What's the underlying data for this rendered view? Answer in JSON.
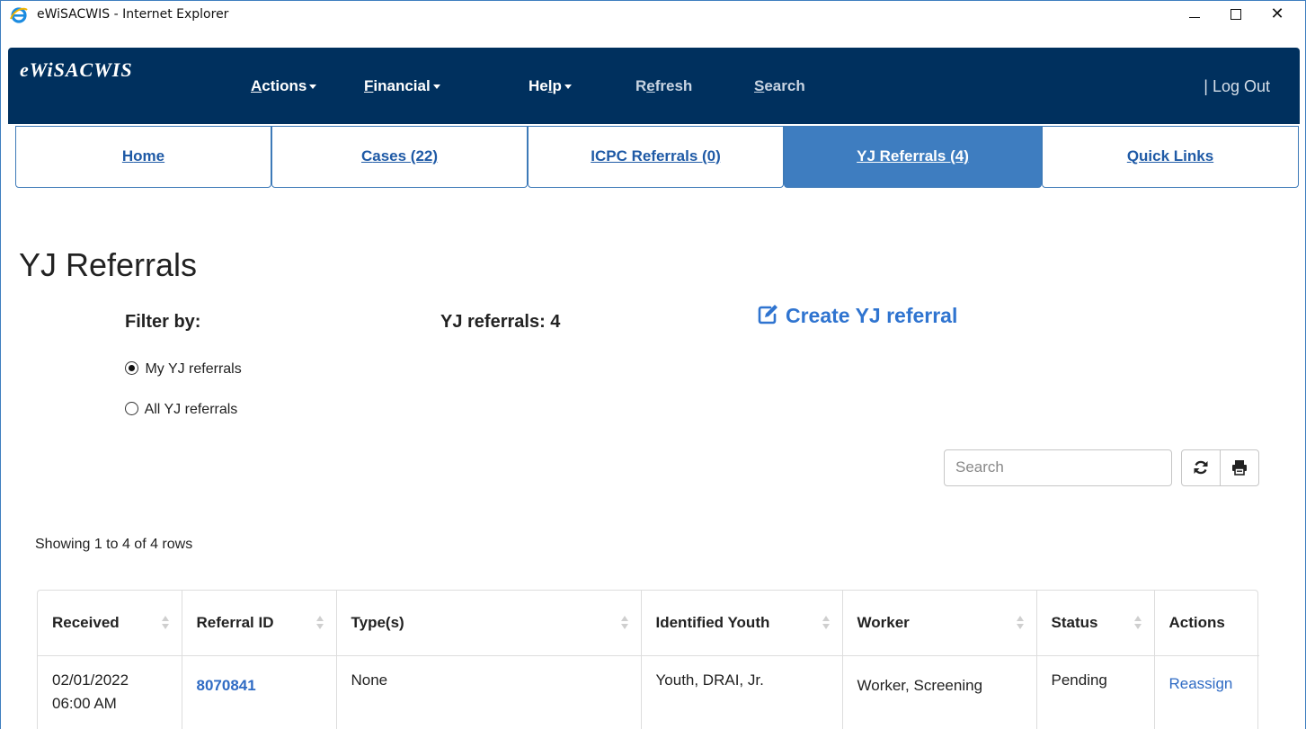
{
  "window": {
    "title": "eWiSACWIS - Internet Explorer",
    "icon": "internet-explorer-icon",
    "controls": {
      "minimize": "minimize-icon",
      "maximize": "maximize-icon",
      "close": "✕"
    }
  },
  "appbar": {
    "logo": "eWiSACWIS",
    "nav": {
      "actions": {
        "first": "A",
        "rest": "ctions"
      },
      "financial": {
        "first": "F",
        "rest": "inancial"
      },
      "help": {
        "pre": "He",
        "u": "l",
        "post": "p"
      },
      "refresh": {
        "pre": "R",
        "u": "e",
        "post": "fresh"
      },
      "search": {
        "first": "S",
        "rest": "earch"
      }
    },
    "logout": "| Log Out",
    "colors": {
      "background": "#00305e",
      "tab_active": "#3e7dc0",
      "link": "#2f74d0"
    }
  },
  "tabs": [
    {
      "pre": "",
      "u": "H",
      "post": "ome",
      "active": false
    },
    {
      "pre": "",
      "u": "C",
      "post": "ases (22)",
      "active": false
    },
    {
      "pre": "",
      "u": "I",
      "post": "CPC Referrals (0)",
      "active": false
    },
    {
      "pre": "",
      "u": "Y",
      "post": "J Referrals (4)",
      "active": true
    },
    {
      "pre": "",
      "u": "Q",
      "post": "uick Links",
      "active": false
    }
  ],
  "page": {
    "title": "YJ Referrals",
    "filter_label": "Filter by:",
    "count_label": "YJ referrals: 4",
    "create_link": "Create YJ referral",
    "create_icon": "edit-icon",
    "filters": [
      {
        "label": "My YJ referrals",
        "checked": true
      },
      {
        "label": "All YJ referrals",
        "checked": false
      }
    ],
    "search": {
      "placeholder": "Search",
      "value": ""
    },
    "toolbar": {
      "refresh_icon": "refresh-icon",
      "print_icon": "print-icon"
    },
    "showing": "Showing 1 to 4 of 4 rows"
  },
  "table": {
    "headers": [
      "Received",
      "Referral ID",
      "Type(s)",
      "Identified Youth",
      "Worker",
      "Status",
      "Actions"
    ],
    "rows": [
      {
        "received": [
          "02/01/2022",
          "06:00 AM"
        ],
        "referral_id": "8070841",
        "types": "None",
        "youth": "Youth, DRAI, Jr.",
        "worker": "Worker, Screening",
        "status": "Pending",
        "action": "Reassign"
      }
    ]
  }
}
